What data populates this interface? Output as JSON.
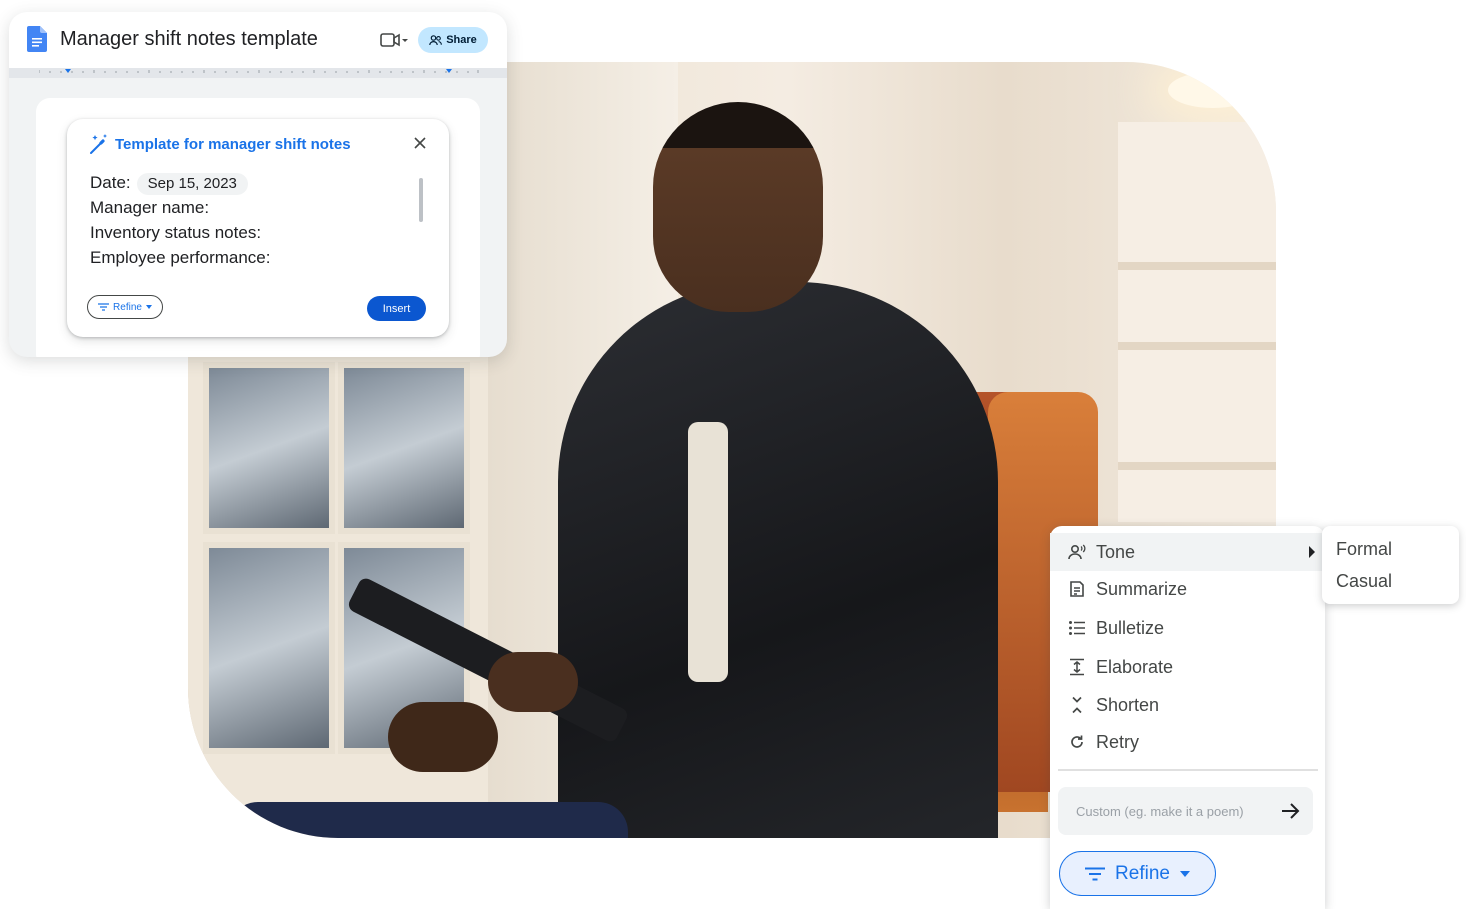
{
  "doc": {
    "title": "Manager shift notes template",
    "share_label": "Share",
    "icons": {
      "app": "google-docs-icon",
      "video": "video-call-icon",
      "share": "people-icon"
    }
  },
  "generator": {
    "title": "Template for manager shift notes",
    "date_label": "Date:",
    "date_value": "Sep 15, 2023",
    "fields": [
      "Manager name:",
      "Inventory status notes:",
      "Employee performance:"
    ],
    "refine_label": "Refine",
    "insert_label": "Insert"
  },
  "menu": {
    "items": [
      {
        "label": "Tone",
        "icon": "voice-tone-icon"
      },
      {
        "label": "Summarize",
        "icon": "summarize-icon"
      },
      {
        "label": "Bulletize",
        "icon": "bulleted-list-icon"
      },
      {
        "label": "Elaborate",
        "icon": "expand-icon"
      },
      {
        "label": "Shorten",
        "icon": "shorten-icon"
      },
      {
        "label": "Retry",
        "icon": "refresh-icon"
      }
    ],
    "custom_placeholder": "Custom (eg. make it a poem)",
    "refine_label": "Refine"
  },
  "tone_submenu": [
    "Formal",
    "Casual"
  ],
  "colors": {
    "accent": "#1a73e8",
    "share_bg": "#c2e7ff",
    "insert_bg": "#0b57d0"
  }
}
